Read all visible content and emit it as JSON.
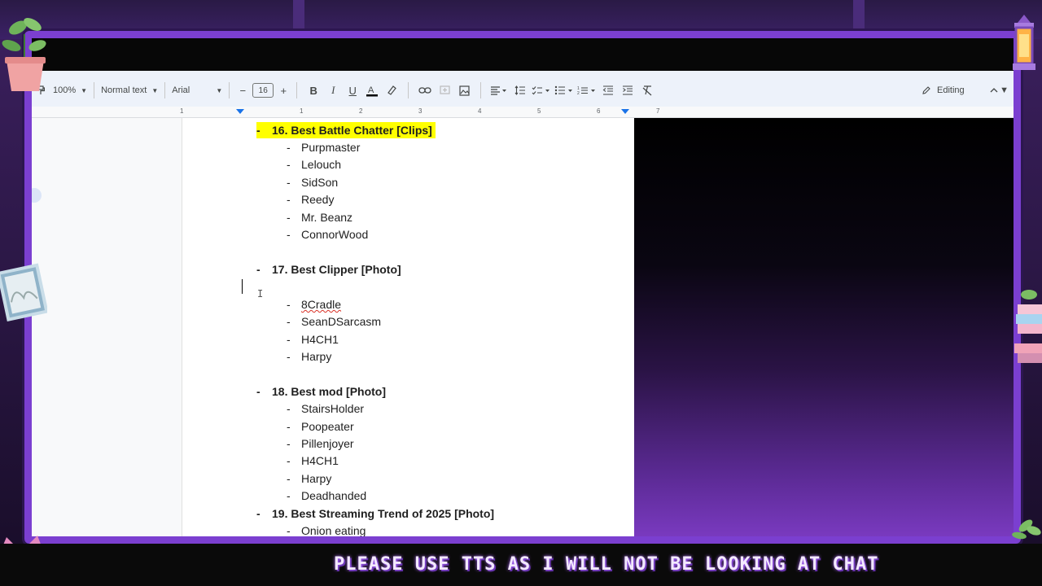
{
  "toolbar": {
    "zoom": "100%",
    "style": "Normal text",
    "font": "Arial",
    "font_size": "16",
    "mode": "Editing"
  },
  "ruler": {
    "ticks": [
      "1",
      "1",
      "2",
      "3",
      "4",
      "5",
      "6",
      "7"
    ]
  },
  "document": {
    "sections": [
      {
        "heading": "16. Best Battle Chatter [Clips]",
        "highlighted": true,
        "items": [
          "Purpmaster",
          "Lelouch",
          "SidSon",
          "Reedy",
          "Mr. Beanz",
          "ConnorWood"
        ]
      },
      {
        "heading": "17. Best Clipper [Photo]",
        "highlighted": false,
        "items": [
          "8Cradle",
          "SeanDSarcasm",
          "H4CH1",
          "Harpy"
        ]
      },
      {
        "heading": "18. Best mod [Photo]",
        "highlighted": false,
        "items": [
          "StairsHolder",
          "Poopeater",
          "Pillenjoyer",
          "H4CH1",
          "Harpy",
          "Deadhanded"
        ]
      },
      {
        "heading": "19. Best Streaming Trend of 2025 [Photo]",
        "highlighted": false,
        "items": [
          "Onion eating"
        ]
      }
    ],
    "dash": "-"
  },
  "overlay": {
    "ticker": "PLEASE USE TTS AS I WILL NOT BE LOOKING AT CHAT",
    "accent": "#7b3fd0"
  },
  "colors": {
    "highlight": "#ffff00",
    "toolbar_bg": "#edf2fa",
    "ruler_marker": "#1a73e8"
  }
}
